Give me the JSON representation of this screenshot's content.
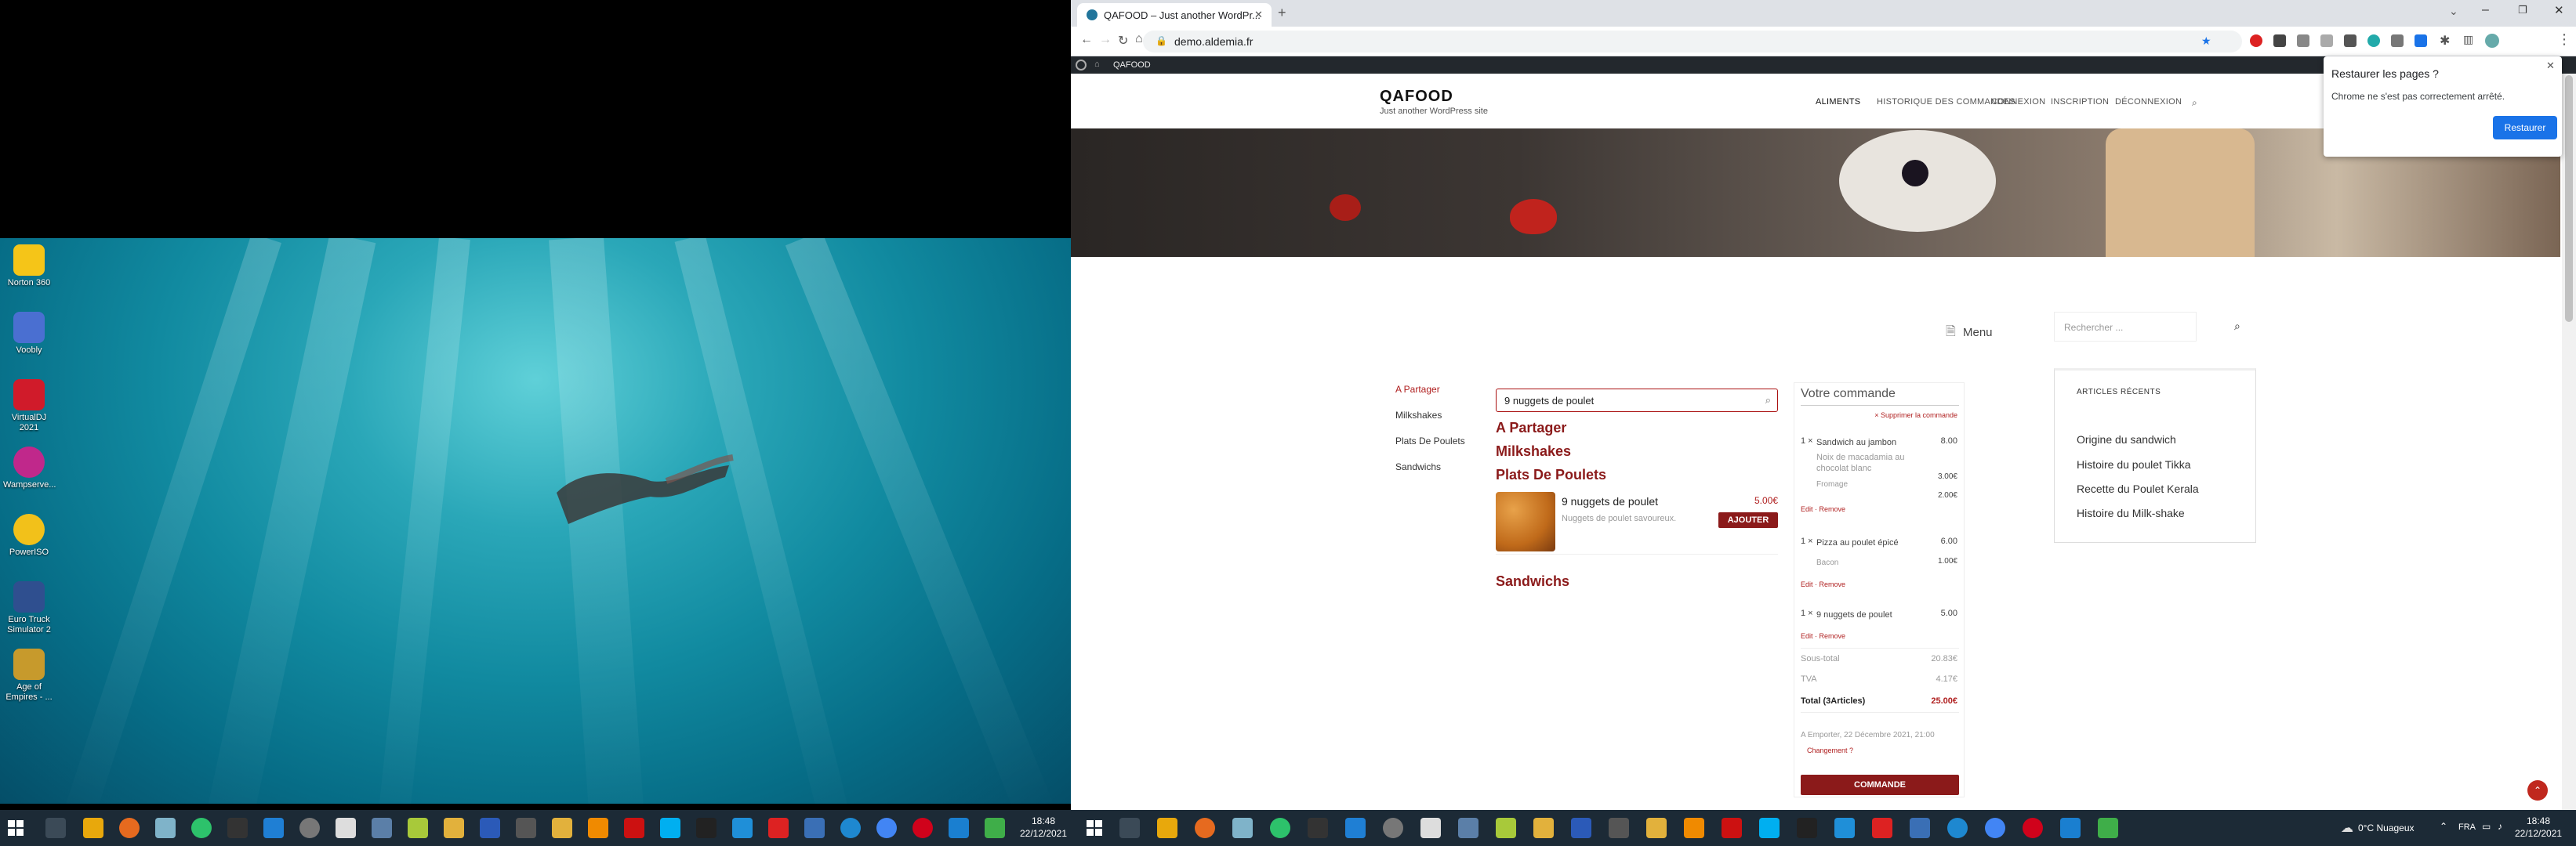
{
  "desktop": {
    "icons": [
      {
        "label": "Norton 360",
        "icon": "norton-icon",
        "color": "#f5c518"
      },
      {
        "label": "Voobly",
        "icon": "voobly-icon",
        "color": "#4a6fd1"
      },
      {
        "label": "VirtualDJ 2021",
        "icon": "virtualdj-icon",
        "color": "#d01b2a"
      },
      {
        "label": "Wampserve...",
        "icon": "wampserver-icon",
        "color": "#c0288b"
      },
      {
        "label": "PowerISO",
        "icon": "poweriso-icon",
        "color": "#f2c11a"
      },
      {
        "label": "Euro Truck Simulator 2",
        "icon": "truck-icon",
        "color": "#2f4f8f"
      },
      {
        "label": "Age of Empires - ...",
        "icon": "aoe-icon",
        "color": "#c79a2c"
      }
    ],
    "clock_time": "18:48",
    "clock_date": "22/12/2021"
  },
  "browser": {
    "tab_title": "QAFOOD – Just another WordPr...",
    "url": "demo.aldemia.fr",
    "restore_popup": {
      "title": "Restaurer les pages ?",
      "message": "Chrome ne s'est pas correctement arrêté.",
      "button": "Restaurer"
    }
  },
  "wp_admin_bar": {
    "site": "QAFOOD"
  },
  "site": {
    "title": "QAFOOD",
    "tagline": "Just another WordPress site",
    "nav": [
      "ALIMENTS",
      "HISTORIQUE DES COMMANDES",
      "CONNEXION",
      "INSCRIPTION",
      "DÉCONNEXION"
    ],
    "menu_label": "Menu",
    "categories": [
      "A Partager",
      "Milkshakes",
      "Plats De Poulets",
      "Sandwichs"
    ],
    "search_value": "9 nuggets de poulet",
    "sections": [
      "A Partager",
      "Milkshakes",
      "Plats De Poulets",
      "Sandwichs"
    ],
    "product": {
      "name": "9 nuggets de poulet",
      "price": "5.00€",
      "desc": "Nuggets de poulet savoureux.",
      "add_button": "AJOUTER"
    },
    "order": {
      "title": "Votre commande",
      "clear": "× Supprimer la commande",
      "items": [
        {
          "qty": "1 ×",
          "name": "Sandwich au jambon",
          "price": "8.00",
          "options": [
            {
              "name": "Noix de macadamia au chocolat blanc",
              "price": "3.00€"
            },
            {
              "name": "Fromage",
              "price": "2.00€"
            }
          ]
        },
        {
          "qty": "1 ×",
          "name": "Pizza au poulet épicé",
          "price": "6.00",
          "options": [
            {
              "name": "Bacon",
              "price": "1.00€"
            }
          ]
        },
        {
          "qty": "1 ×",
          "name": "9 nuggets de poulet",
          "price": "5.00",
          "options": []
        }
      ],
      "edit_remove": "Edit · Remove",
      "subtotal_label": "Sous-total",
      "subtotal": "20.83€",
      "tva_label": "TVA",
      "tva": "4.17€",
      "total_label": "Total (3Articles)",
      "total": "25.00€",
      "pickup": "A Emporter, 22 Décembre 2021, 21:00",
      "change": "Changement ?",
      "checkout": "COMMANDE"
    },
    "sidebar": {
      "search_placeholder": "Rechercher ...",
      "recent_title": "ARTICLES RÉCENTS",
      "recent": [
        "Origine du sandwich",
        "Histoire du poulet Tikka",
        "Recette du Poulet Kerala",
        "Histoire du Milk-shake"
      ]
    }
  },
  "taskbar_right": {
    "weather": "0°C Nuageux",
    "lang": "FRA",
    "clock_time": "18:48",
    "clock_date": "22/12/2021"
  },
  "colors": {
    "accent": "#8b1a1a",
    "chrome_blue": "#1a73e8",
    "taskbar": "#1c2a36"
  }
}
